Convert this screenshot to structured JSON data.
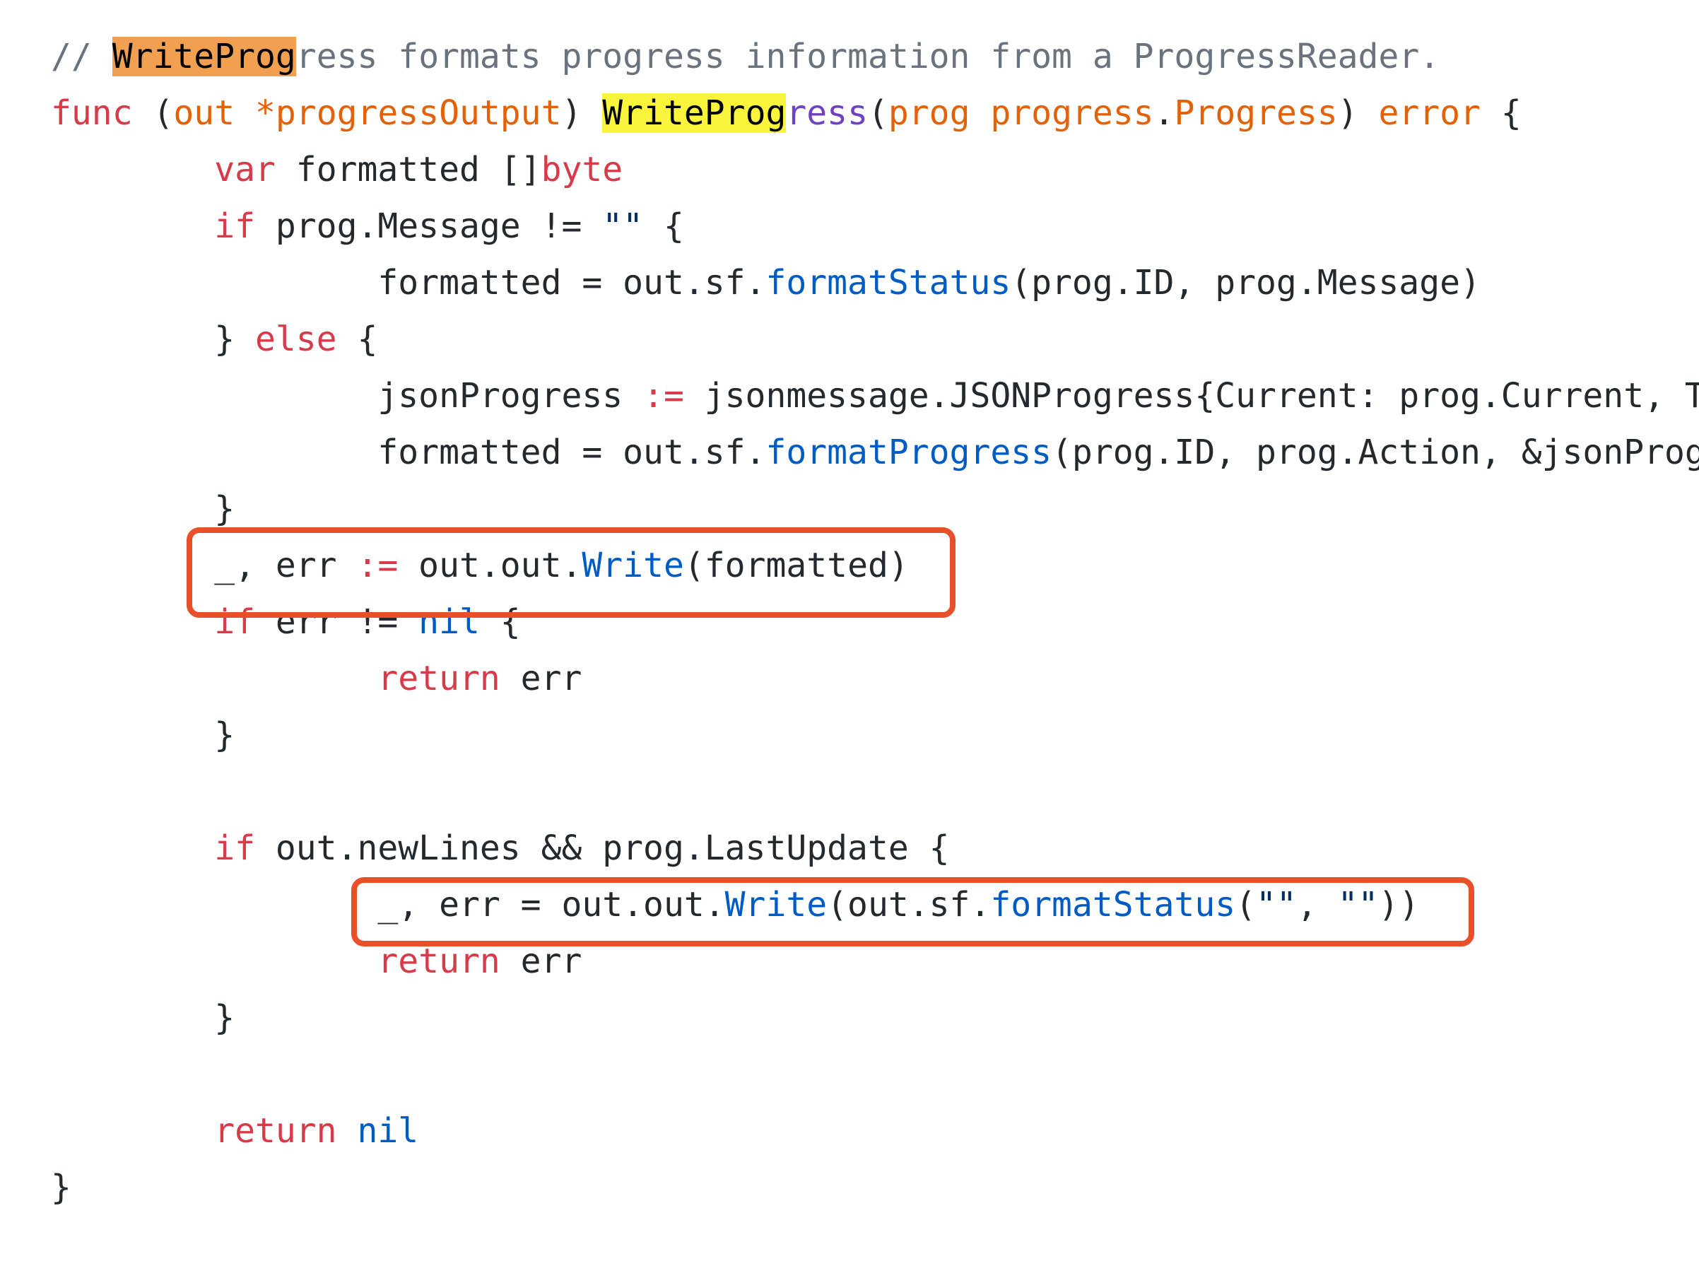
{
  "search": {
    "query": "WriteProg"
  },
  "colors": {
    "comment": "#6a737d",
    "keyword": "#d73a49",
    "function": "#005cc5",
    "string": "#032f62",
    "parameter": "#e36209",
    "receiver": "#6f42c1",
    "text": "#24292e",
    "current_match_highlight": "#f0a050",
    "match_highlight": "#f9f43c",
    "annotation_box": "#e9502a"
  },
  "annotations": {
    "boxed_lines": [
      10,
      16
    ]
  },
  "code": {
    "lines": [
      [
        {
          "t": "// ",
          "c": "comment"
        },
        {
          "t": "WriteProg",
          "c": "comment",
          "hl": "current"
        },
        {
          "t": "ress formats progress information from a ProgressReader.",
          "c": "comment"
        }
      ],
      [
        {
          "t": "func",
          "c": "keyword"
        },
        {
          "t": " (",
          "c": "plain"
        },
        {
          "t": "out",
          "c": "param"
        },
        {
          "t": " ",
          "c": "plain"
        },
        {
          "t": "*progressOutput",
          "c": "param"
        },
        {
          "t": ") ",
          "c": "plain"
        },
        {
          "t": "WriteProg",
          "c": "plain",
          "hl": "match"
        },
        {
          "t": "ress",
          "c": "receiver"
        },
        {
          "t": "(",
          "c": "plain"
        },
        {
          "t": "prog",
          "c": "param"
        },
        {
          "t": " ",
          "c": "plain"
        },
        {
          "t": "progress",
          "c": "param"
        },
        {
          "t": ".",
          "c": "plain"
        },
        {
          "t": "Progress",
          "c": "param"
        },
        {
          "t": ") ",
          "c": "plain"
        },
        {
          "t": "error",
          "c": "param"
        },
        {
          "t": " {",
          "c": "plain"
        }
      ],
      [
        {
          "t": "        ",
          "c": "plain"
        },
        {
          "t": "var",
          "c": "keyword"
        },
        {
          "t": " formatted []",
          "c": "plain"
        },
        {
          "t": "byte",
          "c": "type"
        }
      ],
      [
        {
          "t": "        ",
          "c": "plain"
        },
        {
          "t": "if",
          "c": "keyword"
        },
        {
          "t": " prog.Message != ",
          "c": "plain"
        },
        {
          "t": "\"\"",
          "c": "string"
        },
        {
          "t": " {",
          "c": "plain"
        }
      ],
      [
        {
          "t": "                formatted = out.sf.",
          "c": "plain"
        },
        {
          "t": "formatStatus",
          "c": "func"
        },
        {
          "t": "(prog.ID, prog.Message)",
          "c": "plain"
        }
      ],
      [
        {
          "t": "        } ",
          "c": "plain"
        },
        {
          "t": "else",
          "c": "keyword"
        },
        {
          "t": " {",
          "c": "plain"
        }
      ],
      [
        {
          "t": "                jsonProgress ",
          "c": "plain"
        },
        {
          "t": ":=",
          "c": "keyword"
        },
        {
          "t": " jsonmessage.JSONProgress{Current: prog.Current, T",
          "c": "plain"
        }
      ],
      [
        {
          "t": "                formatted = out.sf.",
          "c": "plain"
        },
        {
          "t": "formatProgress",
          "c": "func"
        },
        {
          "t": "(prog.ID, prog.Action, &jsonProg",
          "c": "plain"
        }
      ],
      [
        {
          "t": "        }",
          "c": "plain"
        }
      ],
      [
        {
          "t": "        _, err ",
          "c": "plain"
        },
        {
          "t": ":=",
          "c": "keyword"
        },
        {
          "t": " out.out.",
          "c": "plain"
        },
        {
          "t": "Write",
          "c": "func"
        },
        {
          "t": "(formatted)",
          "c": "plain"
        }
      ],
      [
        {
          "t": "        ",
          "c": "plain"
        },
        {
          "t": "if",
          "c": "keyword"
        },
        {
          "t": " err != ",
          "c": "plain"
        },
        {
          "t": "nil",
          "c": "const"
        },
        {
          "t": " {",
          "c": "plain"
        }
      ],
      [
        {
          "t": "                ",
          "c": "plain"
        },
        {
          "t": "return",
          "c": "keyword"
        },
        {
          "t": " err",
          "c": "plain"
        }
      ],
      [
        {
          "t": "        }",
          "c": "plain"
        }
      ],
      [],
      [
        {
          "t": "        ",
          "c": "plain"
        },
        {
          "t": "if",
          "c": "keyword"
        },
        {
          "t": " out.newLines && prog.LastUpdate {",
          "c": "plain"
        }
      ],
      [
        {
          "t": "                _, err = out.out.",
          "c": "plain"
        },
        {
          "t": "Write",
          "c": "func"
        },
        {
          "t": "(out.sf.",
          "c": "plain"
        },
        {
          "t": "formatStatus",
          "c": "func"
        },
        {
          "t": "(",
          "c": "plain"
        },
        {
          "t": "\"\"",
          "c": "string"
        },
        {
          "t": ", ",
          "c": "plain"
        },
        {
          "t": "\"\"",
          "c": "string"
        },
        {
          "t": "))",
          "c": "plain"
        }
      ],
      [
        {
          "t": "                ",
          "c": "plain"
        },
        {
          "t": "return",
          "c": "keyword"
        },
        {
          "t": " err",
          "c": "plain"
        }
      ],
      [
        {
          "t": "        }",
          "c": "plain"
        }
      ],
      [],
      [
        {
          "t": "        ",
          "c": "plain"
        },
        {
          "t": "return",
          "c": "keyword"
        },
        {
          "t": " ",
          "c": "plain"
        },
        {
          "t": "nil",
          "c": "const"
        }
      ],
      [
        {
          "t": "}",
          "c": "plain"
        }
      ]
    ]
  }
}
